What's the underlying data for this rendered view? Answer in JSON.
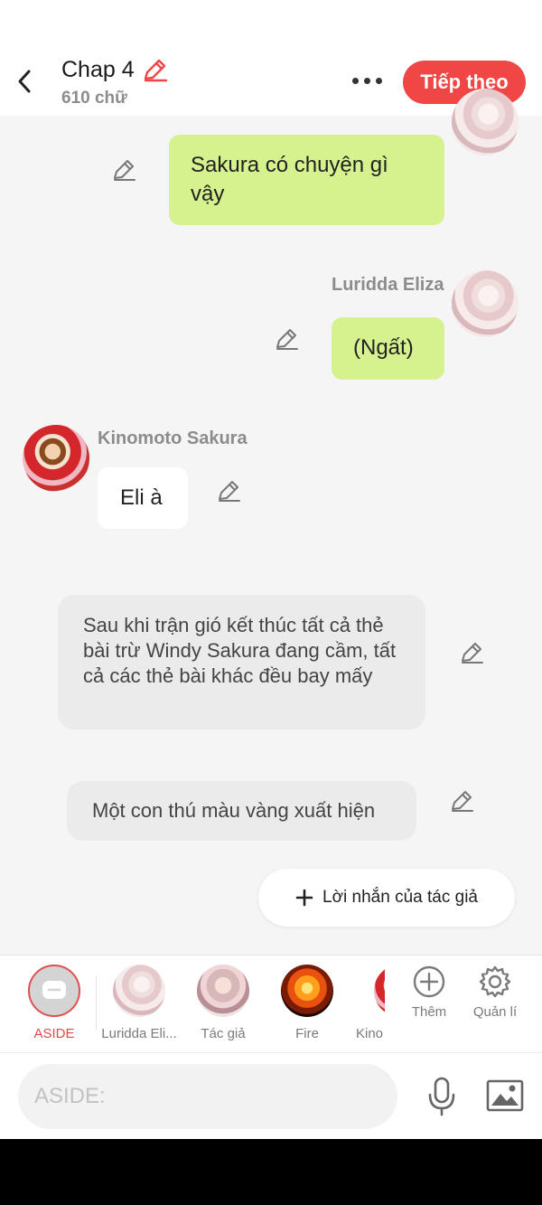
{
  "header": {
    "title": "Chap 4",
    "word_count": "610 chữ",
    "next_label": "Tiếp theo"
  },
  "messages": [
    {
      "sender": "",
      "text": "Sakura có chuyện gì vậy",
      "side": "right",
      "style": "green"
    },
    {
      "sender": "Luridda Eliza",
      "text": "(Ngất)",
      "side": "right",
      "style": "green"
    },
    {
      "sender": "Kinomoto Sakura",
      "text": "Eli à",
      "side": "left",
      "style": "white"
    },
    {
      "sender": "",
      "text": "Sau khi trận gió kết thúc tất cả thẻ bài trừ Windy Sakura đang cầm, tất cả các thẻ bài khác đều bay mấy",
      "side": "center",
      "style": "narration"
    },
    {
      "sender": "",
      "text": "Một con thú màu vàng xuất hiện",
      "side": "center",
      "style": "narration"
    }
  ],
  "author_note": {
    "label": "Lời nhắn của tác giả"
  },
  "characters": [
    {
      "label": "ASIDE",
      "selected": true
    },
    {
      "label": "Luridda Eli..."
    },
    {
      "label": "Tác giả"
    },
    {
      "label": "Fire"
    },
    {
      "label": "Kino"
    }
  ],
  "tools": {
    "add_label": "Thêm",
    "manage_label": "Quản lí"
  },
  "input": {
    "placeholder": "ASIDE:"
  },
  "colors": {
    "accent": "#f04646",
    "bubble_green": "#d6f28f",
    "narration_bg": "#ebebeb",
    "screen_bg": "#f5f5f5"
  }
}
